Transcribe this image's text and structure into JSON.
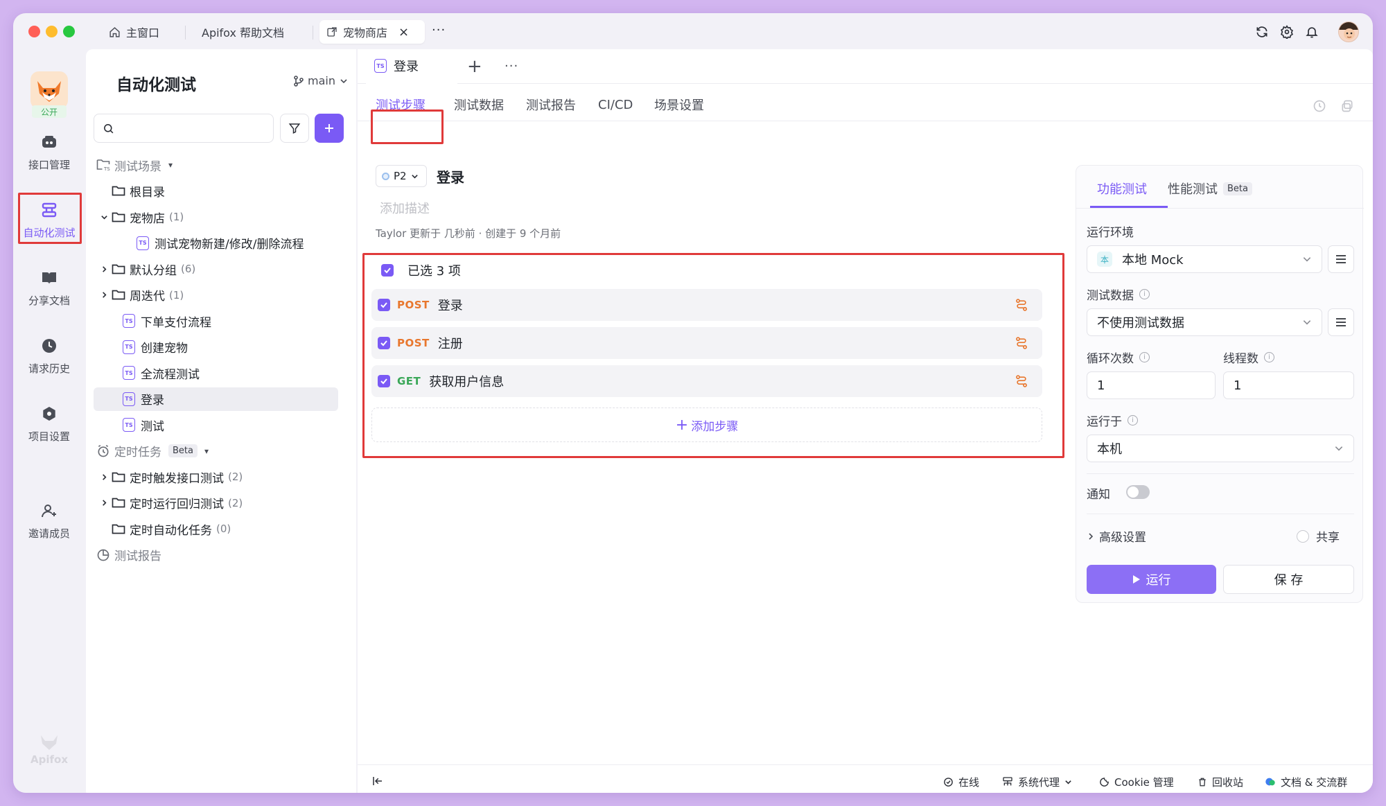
{
  "colors": {
    "accent": "#7a5af5",
    "post": "#e8772e",
    "get": "#3aa758",
    "highlight": "#e03a3a"
  },
  "titlebar": {
    "tabs": [
      {
        "label": "主窗口",
        "icon": "home-icon"
      },
      {
        "label": "Apifox 帮助文档"
      },
      {
        "label": "宠物商店",
        "icon": "external-link-icon",
        "active": true
      }
    ],
    "more": "···"
  },
  "rail": {
    "project_badge": "公开",
    "items": [
      {
        "label": "接口管理",
        "icon": "api-icon"
      },
      {
        "label": "自动化测试",
        "icon": "automation-icon",
        "active": true
      },
      {
        "label": "分享文档",
        "icon": "book-icon"
      },
      {
        "label": "请求历史",
        "icon": "history-icon"
      },
      {
        "label": "项目设置",
        "icon": "settings-icon"
      },
      {
        "label": "邀请成员",
        "icon": "invite-icon"
      }
    ],
    "brand": "Apifox"
  },
  "sidebar": {
    "title": "自动化测试",
    "branch": "main",
    "search_placeholder": "",
    "tree": [
      {
        "label": "测试场景",
        "kind": "section",
        "caret": "▾",
        "icon": "scene-icon"
      },
      {
        "label": "根目录",
        "kind": "folder",
        "indent": 1
      },
      {
        "label": "宠物店",
        "count": "(1)",
        "kind": "folder",
        "indent": 1,
        "arrow": "down"
      },
      {
        "label": "测试宠物新建/修改/删除流程",
        "kind": "ts",
        "indent": 3
      },
      {
        "label": "默认分组",
        "count": "(6)",
        "kind": "folder",
        "indent": 1,
        "arrow": "right"
      },
      {
        "label": "周迭代",
        "count": "(1)",
        "kind": "folder",
        "indent": 1,
        "arrow": "right"
      },
      {
        "label": "下单支付流程",
        "kind": "ts",
        "indent": 2
      },
      {
        "label": "创建宠物",
        "kind": "ts",
        "indent": 2
      },
      {
        "label": "全流程测试",
        "kind": "ts",
        "indent": 2
      },
      {
        "label": "登录",
        "kind": "ts",
        "indent": 2,
        "selected": true
      },
      {
        "label": "测试",
        "kind": "ts",
        "indent": 2
      },
      {
        "label": "定时任务",
        "kind": "section",
        "badge": "Beta",
        "caret": "▾",
        "icon": "clock-icon"
      },
      {
        "label": "定时触发接口测试",
        "count": "(2)",
        "kind": "folder",
        "indent": 1,
        "arrow": "right"
      },
      {
        "label": "定时运行回归测试",
        "count": "(2)",
        "kind": "folder",
        "indent": 1,
        "arrow": "right"
      },
      {
        "label": "定时自动化任务",
        "count": "(0)",
        "kind": "folder",
        "indent": 1
      },
      {
        "label": "测试报告",
        "kind": "section",
        "icon": "report-icon"
      }
    ]
  },
  "main": {
    "doc_tab": "登录",
    "subtabs": [
      "测试步骤",
      "测试数据",
      "测试报告",
      "CI/CD",
      "场景设置"
    ],
    "priority": "P2",
    "scene_title": "登录",
    "desc_placeholder": "添加描述",
    "meta": "Taylor 更新于 几秒前 · 创建于 9 个月前",
    "selected_label": "已选 3 项",
    "steps": [
      {
        "method": "POST",
        "name": "登录"
      },
      {
        "method": "POST",
        "name": "注册"
      },
      {
        "method": "GET",
        "name": "获取用户信息"
      }
    ],
    "add_step": "添加步骤"
  },
  "runner": {
    "tabs": [
      {
        "label": "功能测试",
        "active": true
      },
      {
        "label": "性能测试",
        "badge": "Beta"
      }
    ],
    "env_label": "运行环境",
    "env_badge": "本",
    "env_value": "本地 Mock",
    "data_label": "测试数据",
    "data_value": "不使用测试数据",
    "loop_label": "循环次数",
    "loop_value": "1",
    "thread_label": "线程数",
    "thread_value": "1",
    "runon_label": "运行于",
    "runon_value": "本机",
    "notify_label": "通知",
    "advanced": "高级设置",
    "share": "共享",
    "run": "运行",
    "save": "保 存"
  },
  "statusbar": {
    "items": [
      {
        "label": "在线",
        "icon": "online-icon"
      },
      {
        "label": "系统代理",
        "icon": "proxy-icon"
      },
      {
        "label": "Cookie 管理",
        "icon": "cookie-icon"
      },
      {
        "label": "回收站",
        "icon": "trash-icon"
      },
      {
        "label": "文档 & 交流群",
        "icon": "community-icon"
      }
    ]
  }
}
